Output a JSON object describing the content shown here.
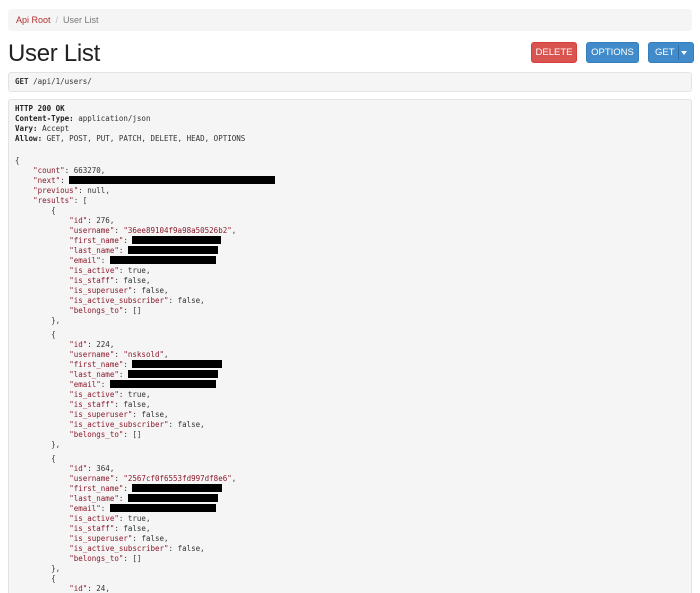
{
  "breadcrumb": {
    "root": "Api Root",
    "separator": "/",
    "current": "User List"
  },
  "page_title": "User List",
  "buttons": {
    "delete": "DELETE",
    "options": "OPTIONS",
    "get": "GET"
  },
  "request": {
    "method": "GET",
    "path": "/api/1/users/"
  },
  "response_headers": {
    "status": "HTTP 200 OK",
    "content_type_label": "Content-Type:",
    "content_type": "application/json",
    "vary_label": "Vary:",
    "vary": "Accept",
    "allow_label": "Allow:",
    "allow": "GET, POST, PUT, PATCH, DELETE, HEAD, OPTIONS"
  },
  "body": {
    "count": "663270",
    "previous": "null",
    "users": [
      {
        "id": "276",
        "username": "\"36ee89104f9a98a50526b2\"",
        "is_active": "true",
        "is_staff": "false",
        "is_superuser": "false",
        "is_active_subscriber": "false",
        "belongs_to": "[]"
      },
      {
        "id": "224",
        "username": "\"nsksold\"",
        "is_active": "true",
        "is_staff": "false",
        "is_superuser": "false",
        "is_active_subscriber": "false",
        "belongs_to": "[]"
      },
      {
        "id": "364",
        "username": "\"2567cf0f6553fd997df8e6\"",
        "is_active": "true",
        "is_staff": "false",
        "is_superuser": "false",
        "is_active_subscriber": "false",
        "belongs_to": "[]"
      },
      {
        "id": "24"
      }
    ]
  }
}
